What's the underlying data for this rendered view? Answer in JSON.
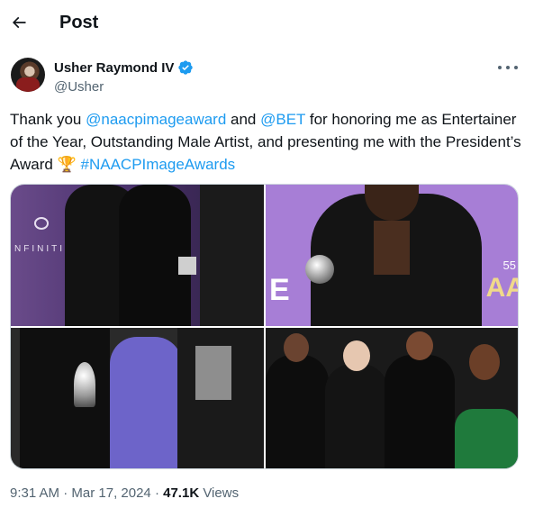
{
  "header": {
    "title": "Post",
    "back_icon": "arrow-left-icon"
  },
  "author": {
    "name": "Usher Raymond IV",
    "handle": "@Usher",
    "verified_color": "#1d9bf0"
  },
  "tweet": {
    "part1": "Thank you ",
    "mention1": "@naacpimageaward",
    "part2": " and ",
    "mention2": "@BET",
    "part3": " for honoring me as Entertainer of the Year, Outstanding Male Artist, and presenting me with the President’s Award ",
    "emoji": "🏆",
    "hashtag": "#NAACPImageAwards",
    "link_color": "#1d9bf0"
  },
  "media": {
    "photo1_text": "NFINITI",
    "photo2_number": "55",
    "photo2_letters": "AA"
  },
  "meta": {
    "time": "9:31 AM",
    "separator": " · ",
    "date": "Mar 17, 2024",
    "views_count": "47.1K",
    "views_label": " Views"
  }
}
